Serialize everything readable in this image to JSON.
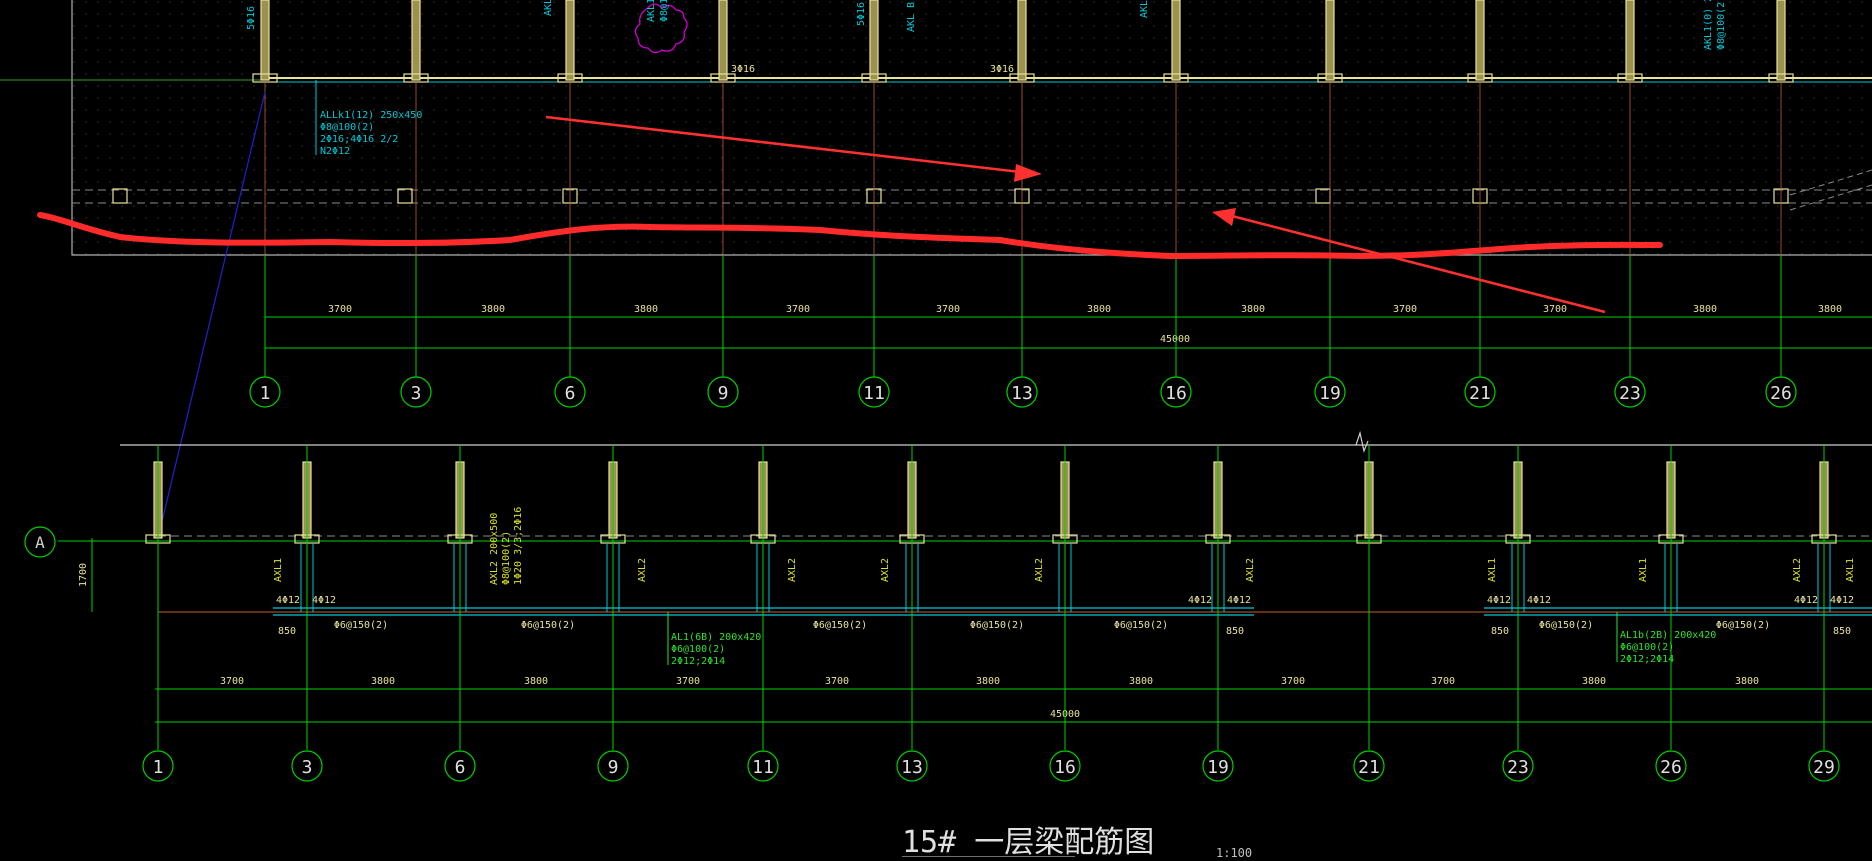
{
  "colors": {
    "background": "#000000",
    "grid": "#00d000",
    "wall": "#e8e29a",
    "beam_cyan": "#00c8d8",
    "beam_text_yellow": "#d8e02a",
    "beam_text_green": "#30e030",
    "dashed": "#8a8a8a",
    "annotation_red": "#ff3030",
    "magenta": "#d000d0",
    "leader_blue": "#2020d0"
  },
  "upper_plan": {
    "axes": [
      "1",
      "3",
      "6",
      "9",
      "11",
      "13",
      "16",
      "19",
      "21",
      "23",
      "26"
    ],
    "dims": [
      "3700",
      "3800",
      "3800",
      "3700",
      "3700",
      "3800",
      "3800",
      "3700",
      "3700",
      "3800",
      "3800"
    ],
    "total": "45000",
    "top_labels": [
      "5Φ16 3Φ",
      "AKL",
      "AKL1(",
      "Φ8@10",
      "3Φ1",
      "5Φ16",
      "AKL B(1",
      "3Φ1",
      "AKL",
      "AKL1(0) 20",
      "Φ8@100(2"
    ],
    "rebar_marks": [
      "3Φ16",
      "3Φ16"
    ],
    "beam_callout": [
      "ALLk1(12) 250x450",
      "Φ8@100(2)",
      "2Φ16;4Φ16 2/2",
      "N2Φ12"
    ]
  },
  "lower_plan": {
    "axis_row": "A",
    "axes": [
      "1",
      "3",
      "6",
      "9",
      "11",
      "13",
      "16",
      "19",
      "21",
      "23",
      "26",
      "29"
    ],
    "dims": [
      "3700",
      "3800",
      "3800",
      "3700",
      "3700",
      "3800",
      "3800",
      "3700",
      "3700",
      "3800",
      "3800"
    ],
    "total": "45000",
    "left_dim": "1700",
    "beam_labels": [
      "AXL1",
      "AXL2",
      "AXL2",
      "AXL2",
      "AXL2",
      "AXL2",
      "AXL1",
      "AXL1",
      "AXL2",
      "AXL1"
    ],
    "rebar_marks": [
      "4Φ12",
      "4Φ12",
      "4Φ12",
      "4Φ12",
      "4Φ12",
      "4Φ12",
      "4Φ12",
      "4Φ12"
    ],
    "stirrups": [
      "Φ6@150(2)",
      "Φ6@150(2)",
      "Φ6@150(2)",
      "Φ6@150(2)",
      "Φ6@150(2)",
      "Φ6@150(2)",
      "Φ6@150(2)"
    ],
    "offsets": [
      "850",
      "850",
      "850",
      "850"
    ],
    "axl2_callout": [
      "AXL2 200x500",
      "Φ8@100(2)",
      "1Φ20 3/3;2Φ16"
    ],
    "al1_callout": [
      "AL1(6B) 200x420",
      "Φ6@100(2)",
      "2Φ12;2Φ14"
    ],
    "al1b_callout": [
      "AL1b(2B) 200x420",
      "Φ6@100(2)",
      "2Φ12;2Φ14"
    ]
  },
  "drawing_title": "15# 一层梁配筋图",
  "scale": "1:100"
}
